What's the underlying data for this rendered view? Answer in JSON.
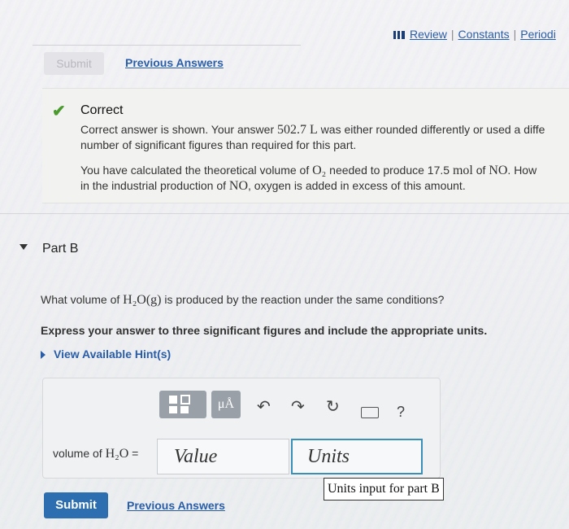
{
  "header": {
    "links": [
      "Review",
      "Constants",
      "Periodi"
    ]
  },
  "top": {
    "submit_label": "Submit",
    "previous_answers": "Previous Answers"
  },
  "feedback": {
    "title": "Correct",
    "line1_pre": "Correct answer is shown. Your answer ",
    "line1_value": "502.7 L",
    "line1_post": " was either rounded differently or used a diffe",
    "line2": "number of significant figures than required for this part.",
    "line3_pre": "You have calculated the theoretical volume of ",
    "line3_formula": "O₂",
    "line3_mid": " needed to produce 17.5 ",
    "line3_unit": "mol",
    "line3_of": " of ",
    "line3_species": "NO",
    "line3_post": ". How",
    "line4_pre": "in the industrial production of ",
    "line4_species": "NO",
    "line4_post": ", oxygen is added in excess of this amount."
  },
  "partB": {
    "title": "Part B",
    "question_pre": "What volume of ",
    "question_formula": "H₂O(g)",
    "question_post": " is produced by the reaction under the same conditions?",
    "instruction": "Express your answer to three significant figures and include the appropriate units.",
    "hint_label": "View Available Hint(s)"
  },
  "toolbar": {
    "templates_icon": "templates-icon",
    "units_label": "μÅ",
    "undo_glyph": "↶",
    "redo_glyph": "↷",
    "reset_glyph": "↻",
    "keyboard_icon": "keyboard-icon",
    "help_label": "?"
  },
  "answer": {
    "label_pre": "volume of ",
    "label_formula": "H₂O",
    "label_post": " =",
    "value_placeholder": "Value",
    "units_placeholder": "Units",
    "units_tooltip": "Units input for part B"
  },
  "bottom": {
    "submit_label": "Submit",
    "previous_answers": "Previous Answers"
  },
  "colors": {
    "link": "#2a5da8",
    "submit": "#2c6eb0",
    "correct": "#4a9a2e",
    "units_border": "#3b8fb7"
  }
}
